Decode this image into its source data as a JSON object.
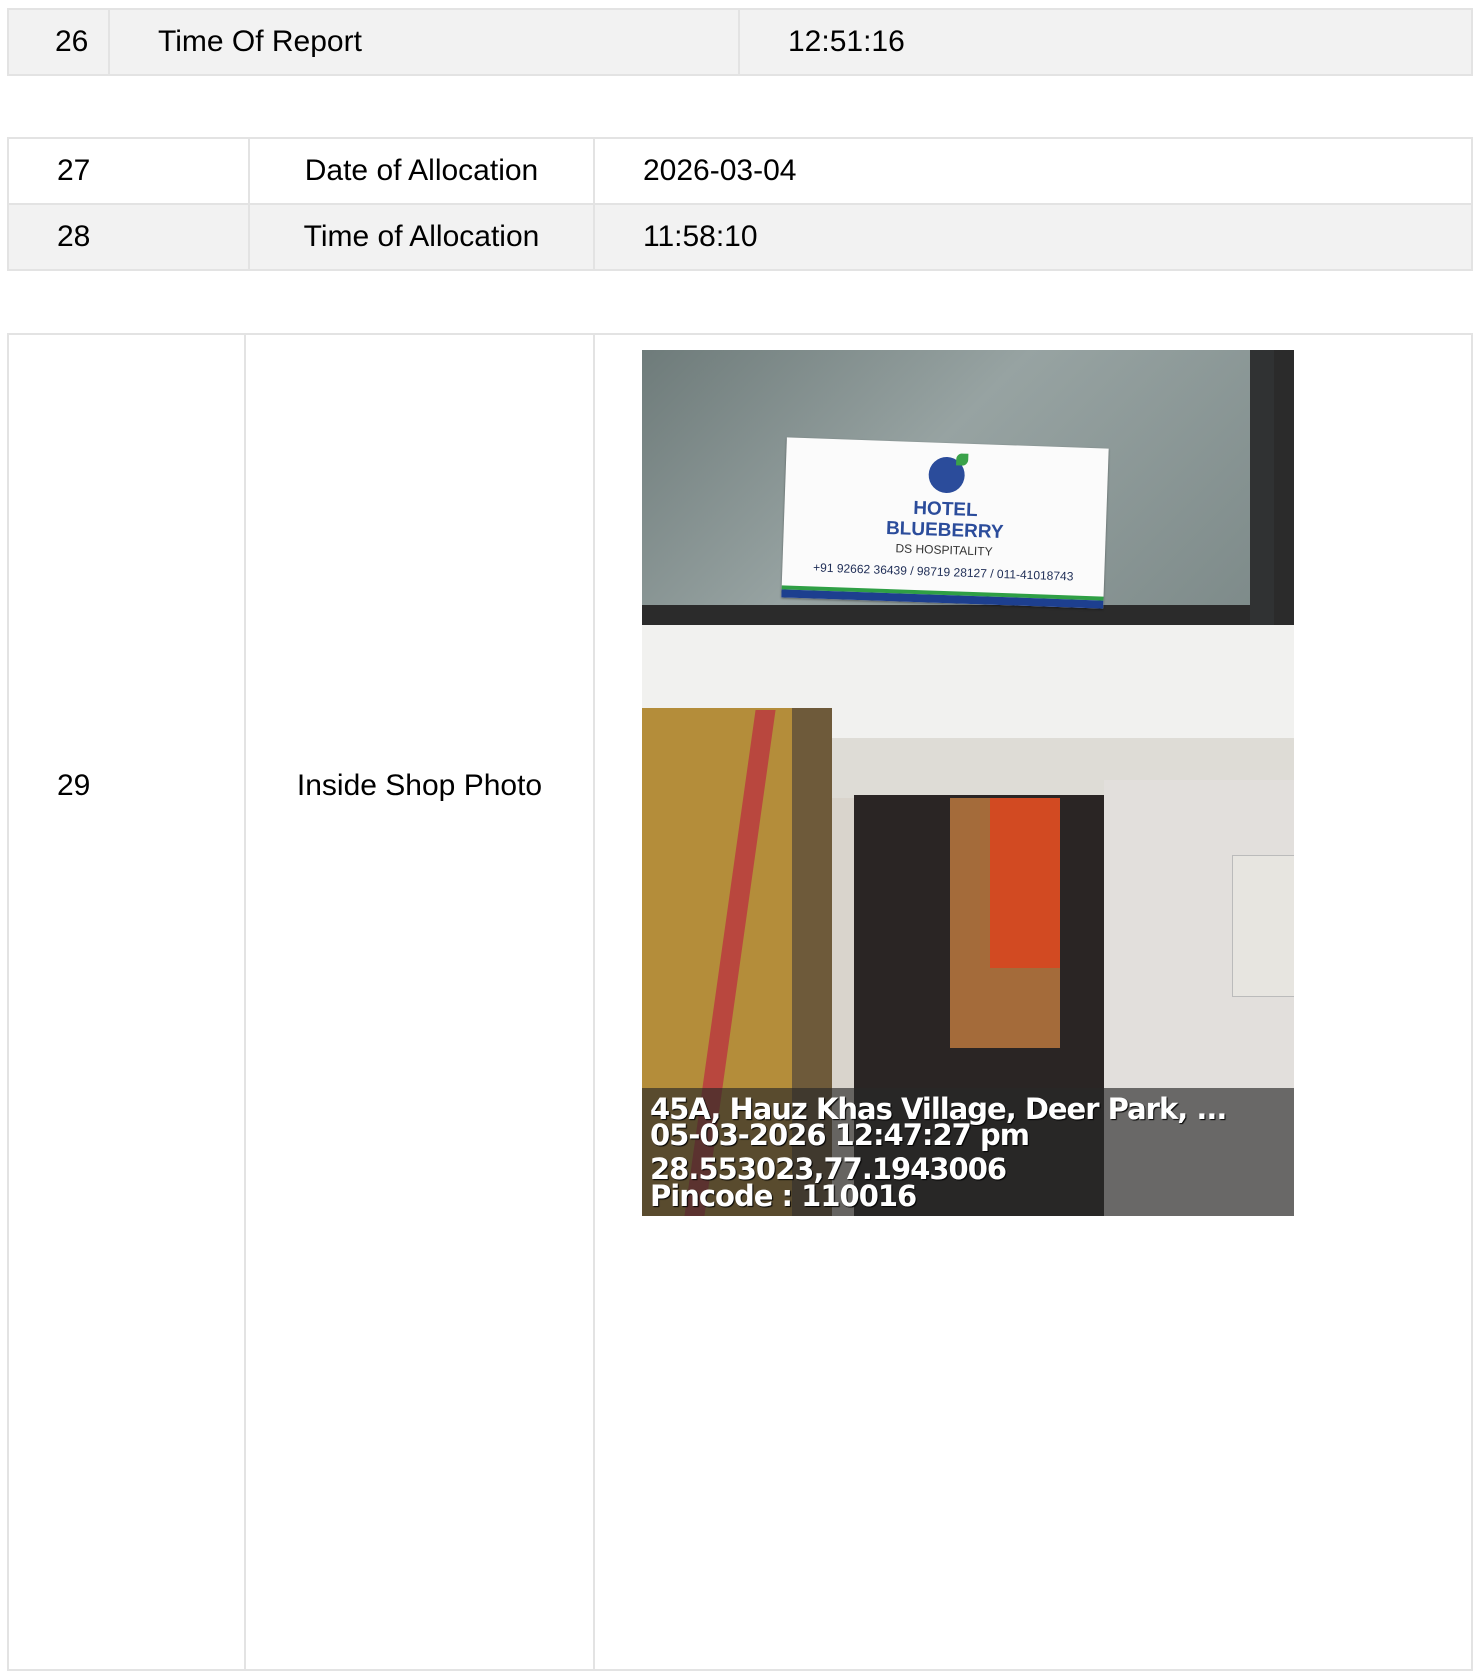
{
  "rows": {
    "time_of_report": {
      "num": "26",
      "label": "Time Of Report",
      "value": "12:51:16"
    },
    "date_of_allocation": {
      "num": "27",
      "label": "Date of Allocation",
      "value": "2026-03-04"
    },
    "time_of_allocation": {
      "num": "28",
      "label": "Time of Allocation",
      "value": "11:58:10"
    },
    "inside_shop_photo": {
      "num": "29",
      "label": "Inside Shop Photo"
    }
  },
  "photo": {
    "sign": {
      "title_line1": "HOTEL",
      "title_line2": "BLUEBERRY",
      "subtitle": "DS HOSPITALITY",
      "phones": "+91 92662 36439 / 98719 28127 / 011-41018743"
    },
    "caption": {
      "address": "45A, Hauz Khas Village, Deer Park, ...",
      "datetime": "05-03-2026 12:47:27 pm",
      "coordinates": "28.553023,77.1943006",
      "pincode": "Pincode : 110016"
    }
  },
  "colors": {
    "row_shade": "#f2f2f2",
    "border": "#e3e3e3",
    "sign_blue": "#2b4c9b"
  }
}
